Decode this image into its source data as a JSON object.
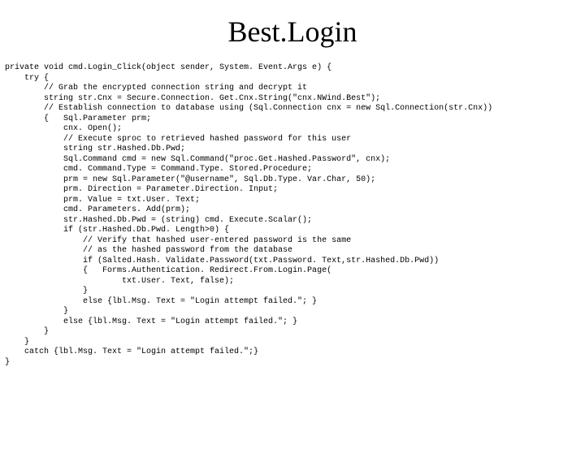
{
  "title": "Best.Login",
  "code": "private void cmd.Login_Click(object sender, System. Event.Args e) {\n    try {\n        // Grab the encrypted connection string and decrypt it\n        string str.Cnx = Secure.Connection. Get.Cnx.String(\"cnx.NWind.Best\");\n        // Establish connection to database using (Sql.Connection cnx = new Sql.Connection(str.Cnx))\n        {   Sql.Parameter prm;\n            cnx. Open();\n            // Execute sproc to retrieved hashed password for this user\n            string str.Hashed.Db.Pwd;\n            Sql.Command cmd = new Sql.Command(\"proc.Get.Hashed.Password\", cnx);\n            cmd. Command.Type = Command.Type. Stored.Procedure;\n            prm = new Sql.Parameter(\"@username\", Sql.Db.Type. Var.Char, 50);\n            prm. Direction = Parameter.Direction. Input;\n            prm. Value = txt.User. Text;\n            cmd. Parameters. Add(prm);\n            str.Hashed.Db.Pwd = (string) cmd. Execute.Scalar();\n            if (str.Hashed.Db.Pwd. Length>0) {\n                // Verify that hashed user-entered password is the same\n                // as the hashed password from the database\n                if (Salted.Hash. Validate.Password(txt.Password. Text,str.Hashed.Db.Pwd))\n                {   Forms.Authentication. Redirect.From.Login.Page(\n                        txt.User. Text, false);\n                }\n                else {lbl.Msg. Text = \"Login attempt failed.\"; }\n            }\n            else {lbl.Msg. Text = \"Login attempt failed.\"; }\n        }\n    }\n    catch {lbl.Msg. Text = \"Login attempt failed.\";}\n}"
}
